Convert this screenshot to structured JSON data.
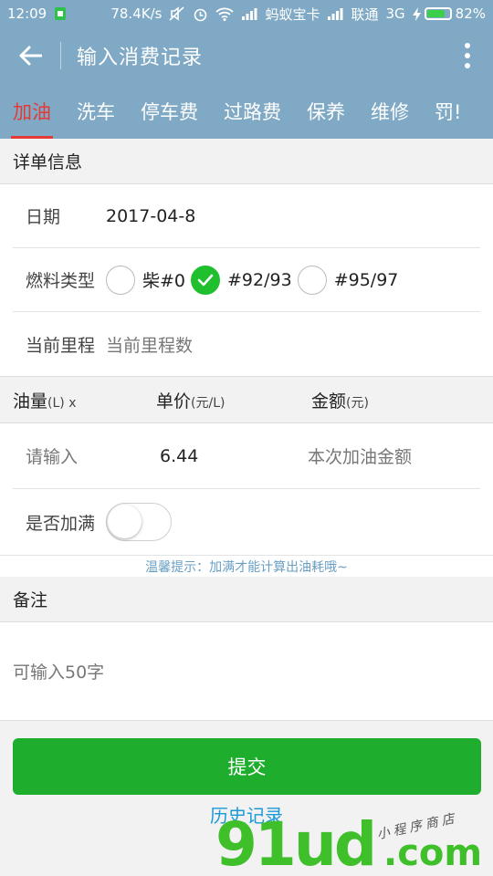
{
  "status_bar": {
    "time": "12:09",
    "net_speed": "78.4K/s",
    "carrier1": "蚂蚁宝卡",
    "carrier2": "联通",
    "network": "3G",
    "battery": "82%",
    "battery_level": 0.82
  },
  "app_bar": {
    "title": "输入消费记录"
  },
  "tabs": [
    {
      "label": "加油",
      "active": true
    },
    {
      "label": "洗车",
      "active": false
    },
    {
      "label": "停车费",
      "active": false
    },
    {
      "label": "过路费",
      "active": false
    },
    {
      "label": "保养",
      "active": false
    },
    {
      "label": "维修",
      "active": false
    },
    {
      "label": "罚!",
      "active": false
    }
  ],
  "detail": {
    "section_title": "详单信息",
    "date_label": "日期",
    "date_value": "2017-04-8",
    "fuel_label": "燃料类型",
    "fuel_options": [
      {
        "label": "柴#0",
        "checked": false
      },
      {
        "label": "#92/93",
        "checked": true
      },
      {
        "label": "#95/97",
        "checked": false
      }
    ],
    "mileage_label": "当前里程",
    "mileage_placeholder": "当前里程数"
  },
  "fuel": {
    "volume_header": "油量",
    "volume_unit": "(L) x",
    "price_header": "单价",
    "price_unit": "(元/L)",
    "amount_header": "金额",
    "amount_unit": "(元)",
    "volume_placeholder": "请输入",
    "price_value": "6.44",
    "amount_placeholder": "本次加油金额",
    "full_label": "是否加满",
    "full_on": false,
    "tip": "温馨提示：加满才能计算出油耗哦~"
  },
  "remark": {
    "section_title": "备注",
    "placeholder": "可输入50字"
  },
  "actions": {
    "submit": "提交",
    "history": "历史记录"
  },
  "watermark": {
    "big": "91ud",
    "com": ".com",
    "small": "小程序商店"
  },
  "colors": {
    "appbar": "#7fa9c4",
    "tab_active": "#e53935",
    "primary_green": "#1fad2e",
    "link_blue": "#1a9ad6"
  }
}
